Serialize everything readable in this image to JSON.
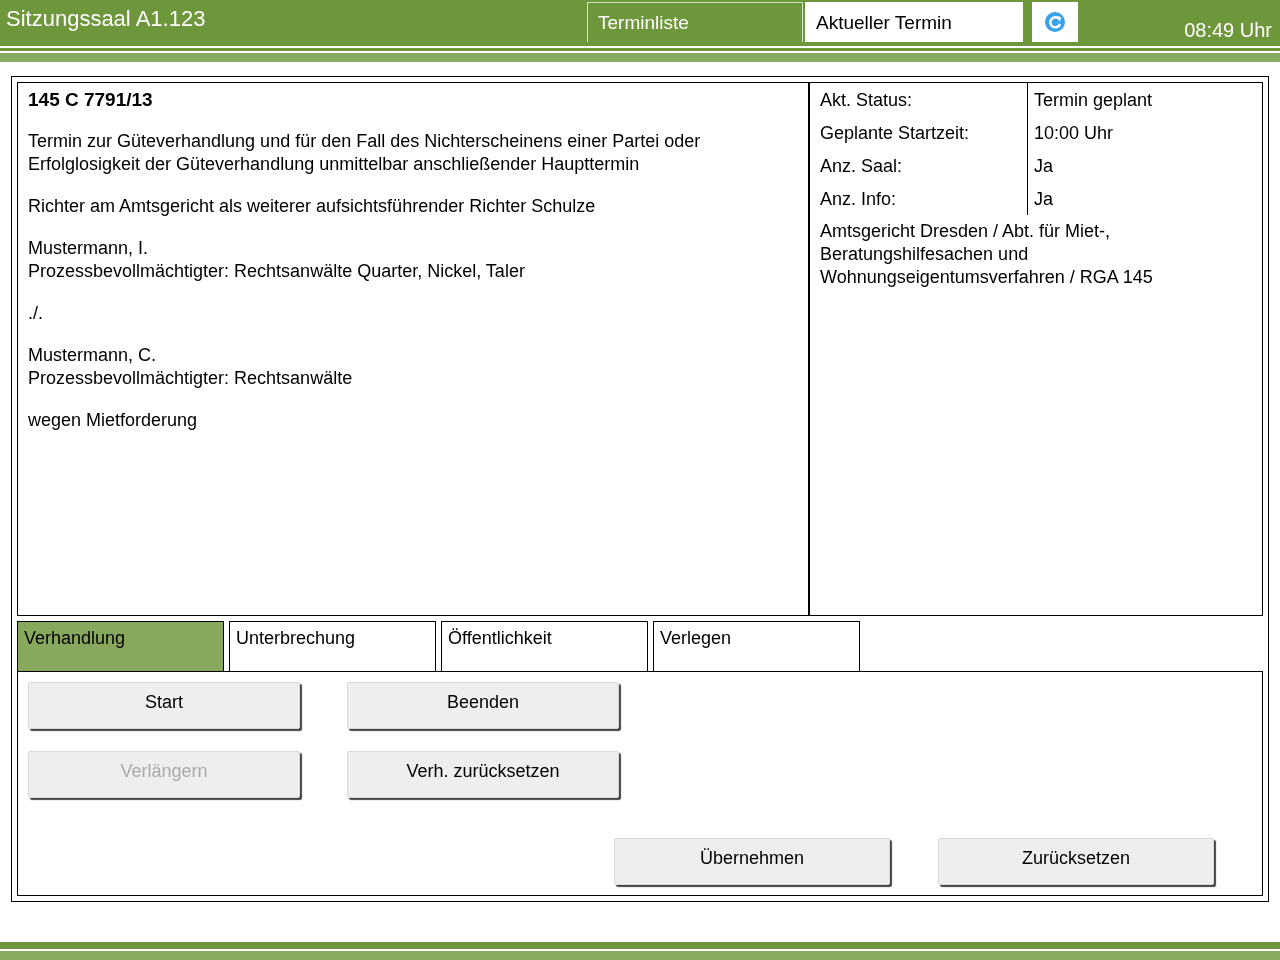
{
  "header": {
    "title": "Sitzungssaal A1.123",
    "nav_tabs": [
      {
        "label": "Terminliste",
        "selected": false
      },
      {
        "label": "Aktueller Termin",
        "selected": true
      }
    ],
    "time": "08:49 Uhr"
  },
  "case": {
    "number": "145 C 7791/13",
    "paragraphs": [
      [
        "Termin zur Güteverhandlung und für den Fall des Nichterscheinens einer Partei oder Erfolglosigkeit der Güteverhandlung unmittelbar anschließender Haupttermin"
      ],
      [
        "Richter am Amtsgericht als weiterer aufsichtsführender Richter Schulze"
      ],
      [
        "Mustermann, I.",
        "Prozessbevollmächtigter: Rechtsanwälte Quarter, Nickel, Taler"
      ],
      [
        "./."
      ],
      [
        "Mustermann, C.",
        "Prozessbevollmächtigter: Rechtsanwälte"
      ],
      [
        "wegen Mietforderung"
      ]
    ]
  },
  "info": {
    "rows": [
      {
        "label": "Akt. Status:",
        "value": "Termin geplant"
      },
      {
        "label": "Geplante Startzeit:",
        "value": "10:00 Uhr"
      },
      {
        "label": "Anz. Saal:",
        "value": "Ja"
      },
      {
        "label": "Anz. Info:",
        "value": "Ja"
      }
    ],
    "court": "Amtsgericht Dresden / Abt. für Miet-, Beratungshilfesachen und Wohnungseigentumsverfahren / RGA 145"
  },
  "action_tabs": [
    {
      "label": "Verhandlung",
      "selected": true
    },
    {
      "label": "Unterbrechung",
      "selected": false
    },
    {
      "label": "Öffentlichkeit",
      "selected": false
    },
    {
      "label": "Verlegen",
      "selected": false
    }
  ],
  "actions": [
    {
      "label": "Start",
      "disabled": false
    },
    {
      "label": "Beenden",
      "disabled": false
    },
    {
      "label": "Verlängern",
      "disabled": true
    },
    {
      "label": "Verh. zurücksetzen",
      "disabled": false
    }
  ],
  "footer_buttons": [
    {
      "label": "Übernehmen",
      "disabled": false
    },
    {
      "label": "Zurücksetzen",
      "disabled": false
    }
  ]
}
